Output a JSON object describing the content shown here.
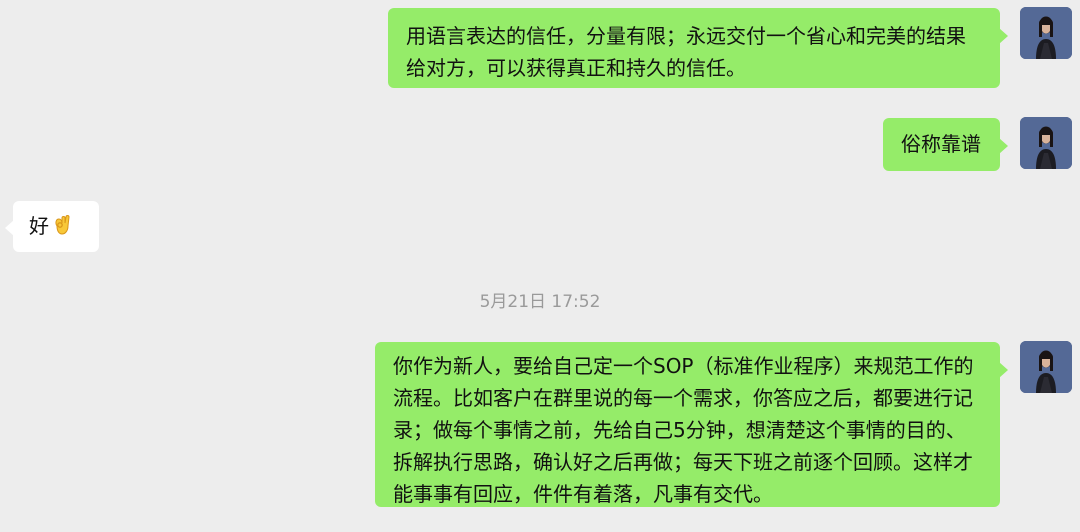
{
  "messages": [
    {
      "sender": "me",
      "text": "用语言表达的信任，分量有限；永远交付一个省心和完美的结果给对方，可以获得真正和持久的信任。"
    },
    {
      "sender": "me",
      "text": "俗称靠谱"
    },
    {
      "sender": "other",
      "text": "好",
      "emoji": "ok-hand-emoji"
    },
    {
      "sender": "me",
      "text": "你作为新人，要给自己定一个SOP（标准作业程序）来规范工作的流程。比如客户在群里说的每一个需求，你答应之后，都要进行记录；做每个事情之前，先给自己5分钟，想清楚这个事情的目的、拆解执行思路，确认好之后再做；每天下班之前逐个回顾。这样才能事事有回应，件件有着落，凡事有交代。"
    }
  ],
  "timestamp": "5月21日 17:52",
  "colors": {
    "background": "#ededed",
    "my_bubble": "#95ec69",
    "their_bubble": "#ffffff",
    "timestamp": "#9a9a9a"
  }
}
